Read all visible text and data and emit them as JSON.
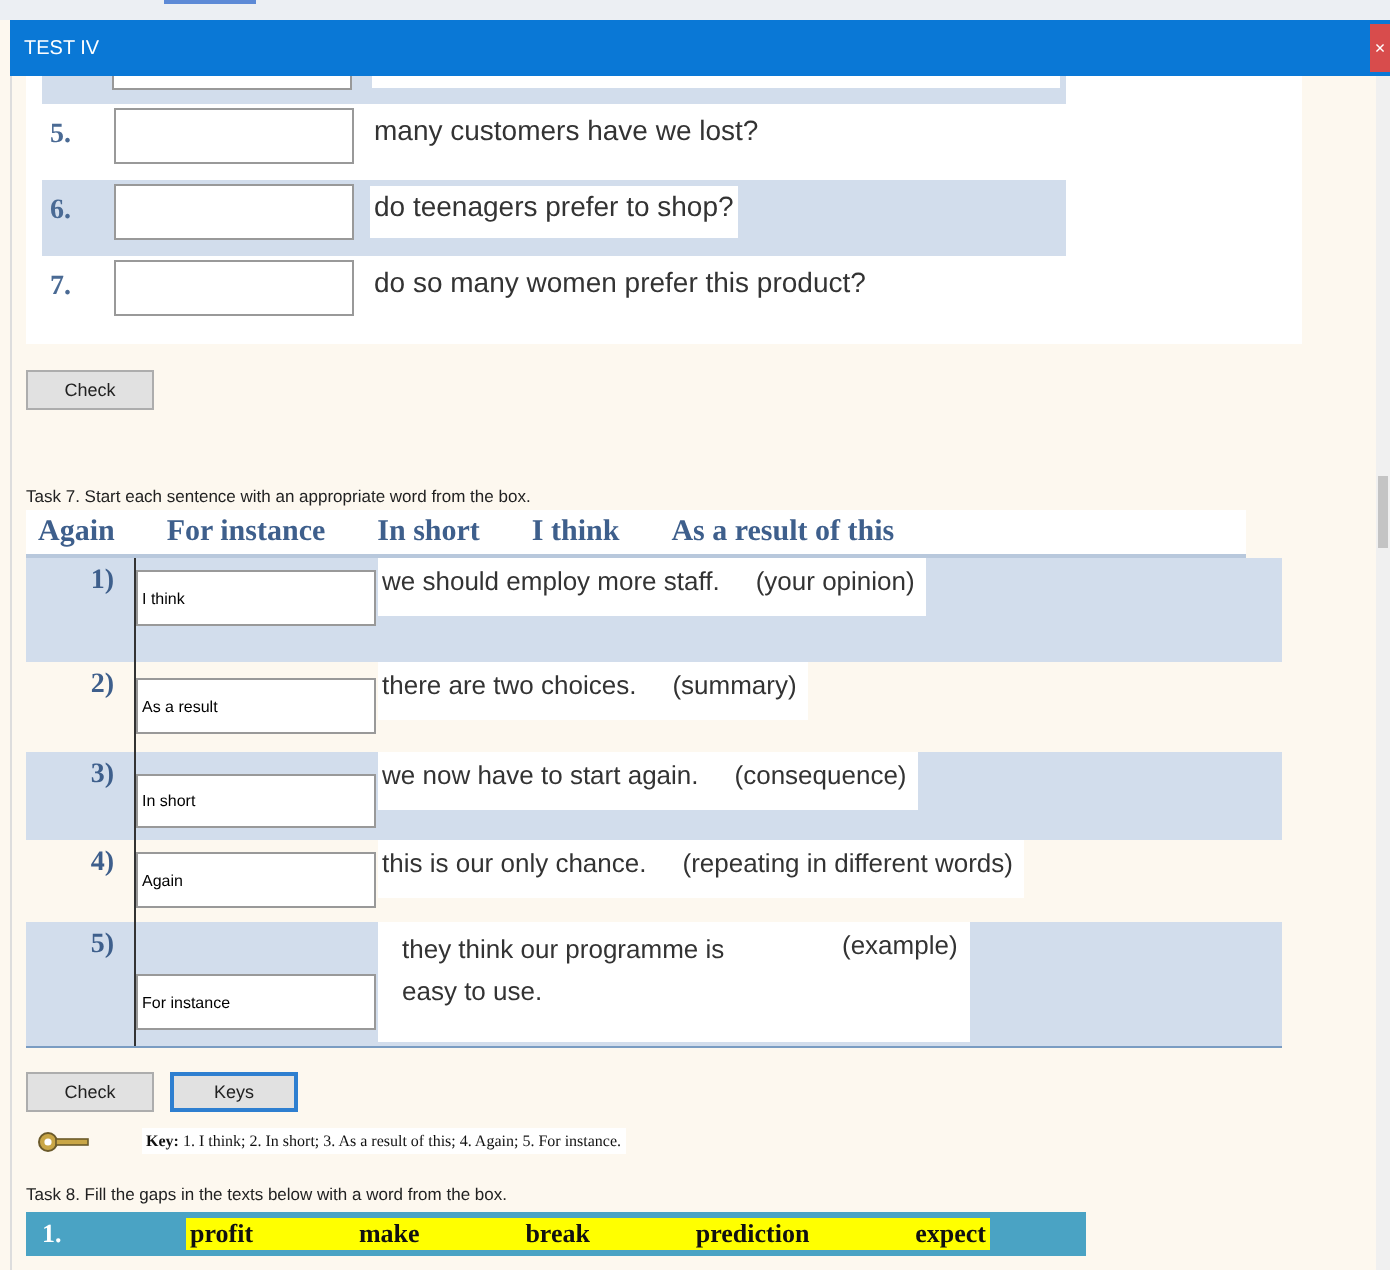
{
  "window": {
    "title": "TEST IV",
    "close": "×"
  },
  "task6": {
    "rows": [
      {
        "number": "5.",
        "answer": "",
        "text": "many customers have we lost?",
        "shaded": false
      },
      {
        "number": "6.",
        "answer": "",
        "text": "do teenagers prefer to shop?",
        "shaded": true
      },
      {
        "number": "7.",
        "answer": "",
        "text": "do so many women prefer this product?",
        "shaded": false
      }
    ],
    "buttons": [
      {
        "label": "Check",
        "focused": false
      }
    ]
  },
  "task7": {
    "instruction": "Task 7. Start each sentence with an appropriate word from the box.",
    "words": [
      "Again",
      "For instance",
      "In short",
      "I think",
      "As a result of this"
    ],
    "rows": [
      {
        "number": "1)",
        "answer": "I think",
        "sentence": "we should employ more staff.",
        "hint": "(your opinion)",
        "shaded": true
      },
      {
        "number": "2)",
        "answer": "As a result",
        "sentence": "there are two choices.",
        "hint": "(summary)",
        "shaded": false
      },
      {
        "number": "3)",
        "answer": "In short",
        "sentence": "we now have to start again.",
        "hint": "(consequence)",
        "shaded": true
      },
      {
        "number": "4)",
        "answer": "Again",
        "sentence": "this is our only chance.",
        "hint": "(repeating in different words)",
        "shaded": false
      },
      {
        "number": "5)",
        "answer": "For instance",
        "sentence": "they think our programme is easy to use.",
        "hint": "(example)",
        "shaded": true
      }
    ],
    "buttons": [
      {
        "label": "Check",
        "focused": false
      },
      {
        "label": "Keys",
        "focused": true
      }
    ],
    "key": "**Key:** 1. I think; 2. In short; 3. As a result of this; 4. Again; 5. For instance."
  },
  "task8": {
    "instruction": "Task 8. Fill the gaps in the texts below with a word from the box.",
    "number": "1.",
    "words": [
      "profit",
      "make",
      "break",
      "prediction",
      "expect"
    ]
  }
}
